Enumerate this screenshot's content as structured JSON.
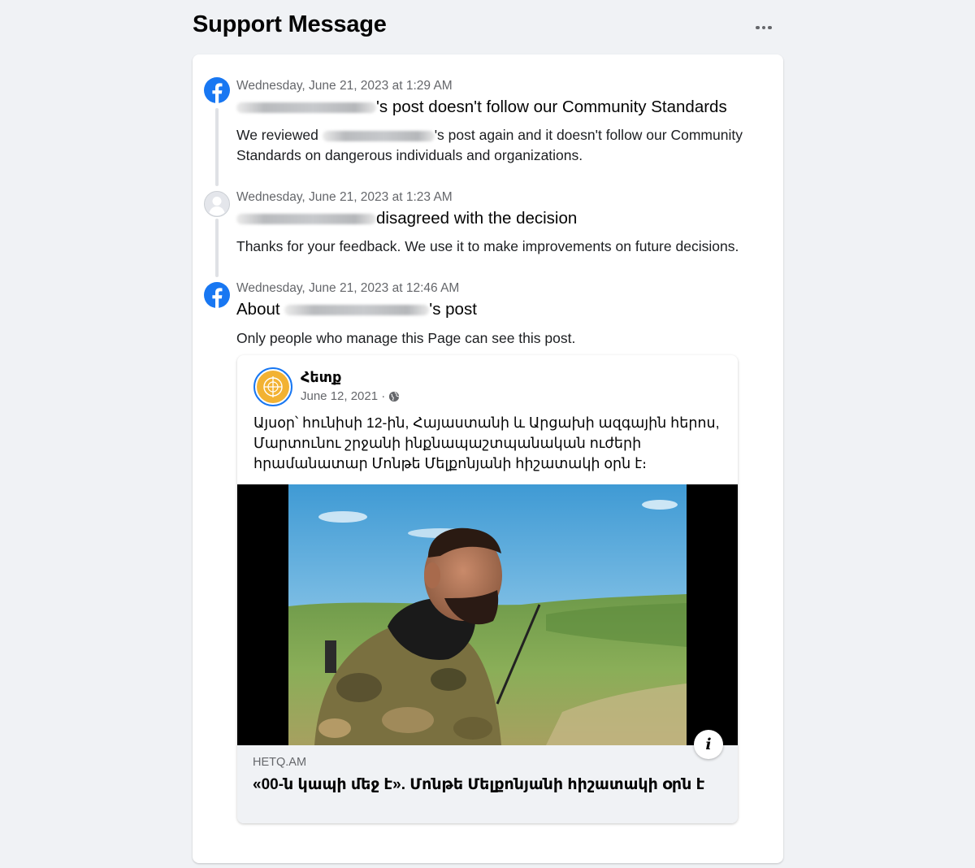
{
  "header": {
    "title": "Support Message"
  },
  "icons": {
    "more": "more-horizontal-icon",
    "facebook": "facebook-logo-icon",
    "user": "default-avatar-icon",
    "globe": "globe-icon",
    "info": "info-icon"
  },
  "colors": {
    "brand": "#1877f2",
    "background": "#f0f2f5",
    "secondary_text": "#65676b"
  },
  "entries": [
    {
      "timestamp": "Wednesday, June 21, 2023 at 1:29 AM",
      "title_suffix": "'s post doesn't follow our Community Standards",
      "body_prefix": "We reviewed ",
      "body_suffix": "'s post again and it doesn't follow our Community Standards on dangerous individuals and organizations."
    },
    {
      "timestamp": "Wednesday, June 21, 2023 at 1:23 AM",
      "title_suffix": "disagreed with the decision",
      "body": "Thanks for your feedback. We use it to make improvements on future decisions."
    },
    {
      "timestamp": "Wednesday, June 21, 2023 at 12:46 AM",
      "title_prefix": "About ",
      "title_suffix": "'s post",
      "body": "Only people who manage this Page can see this post."
    }
  ],
  "post": {
    "page_name": "Հետք",
    "date": "June 12, 2021 ·",
    "text": "Այսօր՝ հունիսի 12-ին, Հայաստանի և Արցախի ազգային հերոս, Մարտունու շրջանի ինքնապաշտպանական ուժերի հրամանատար Մոնթե Մելքոնյանի հիշատակի օրն է։",
    "link_domain": "HETQ.AM",
    "link_title": "«00-ն կապի մեջ է». Մոնթե Մելքոնյանի հիշատակի օրն է",
    "info_label": "i"
  }
}
